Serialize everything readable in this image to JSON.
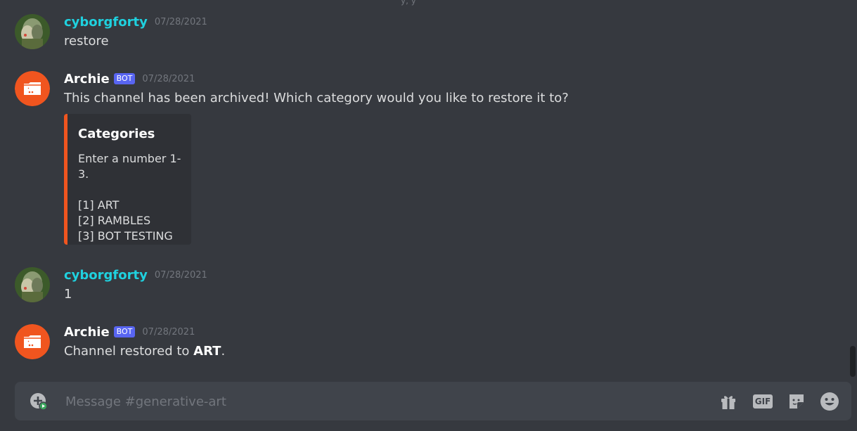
{
  "messages": [
    {
      "author": "cyborgforty",
      "is_bot": false,
      "timestamp": "07/28/2021",
      "content": "restore"
    },
    {
      "author": "Archie",
      "is_bot": true,
      "bot_tag": "BOT",
      "timestamp": "07/28/2021",
      "content": "This channel has been archived! Which category would you like to restore it to?",
      "embed": {
        "title": "Categories",
        "prompt": "Enter a number 1-3.",
        "options": [
          "[1] ART",
          "[2] RAMBLES",
          "[3] BOT TESTING"
        ],
        "accent_color": "#f0551f"
      }
    },
    {
      "author": "cyborgforty",
      "is_bot": false,
      "timestamp": "07/28/2021",
      "content": "1"
    },
    {
      "author": "Archie",
      "is_bot": true,
      "bot_tag": "BOT",
      "timestamp": "07/28/2021",
      "content_prefix": "Channel restored to ",
      "content_bold": "ART",
      "content_suffix": "."
    }
  ],
  "composer": {
    "placeholder": "Message #generative-art",
    "gif_label": "GIF",
    "icons": [
      "attach-icon",
      "gift-icon",
      "gif-icon",
      "sticker-icon",
      "emoji-icon"
    ]
  },
  "colors": {
    "background": "#36393f",
    "user_name": "#1fd1df",
    "bot_tag": "#5865f2",
    "archie_avatar": "#f0551f",
    "composer": "#40444b"
  }
}
